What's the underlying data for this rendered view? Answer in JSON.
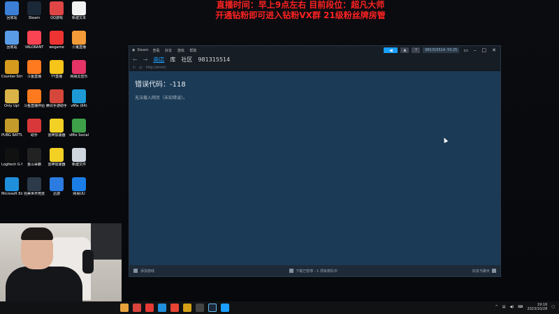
{
  "overlay": {
    "line1": "直播时间：早上9点左右  目前段位：超凡大师",
    "line2": "开通钻粉即可进入钻粉VX群 21级粉丝牌房管"
  },
  "desktop_icons": [
    {
      "label": "回收站",
      "icon": "recycle-bin-icon",
      "color": "#3c7fd6"
    },
    {
      "label": "Steam",
      "icon": "steam-icon",
      "color": "#1b2838"
    },
    {
      "label": "QQ游戏",
      "icon": "qq-game-icon",
      "color": "#e04646"
    },
    {
      "label": "新建文本",
      "icon": "text-file-icon",
      "color": "#f2f2f2"
    },
    {
      "label": "回收站",
      "icon": "bin-icon",
      "color": "#5a9be6"
    },
    {
      "label": "VALORANT",
      "icon": "valorant-icon",
      "color": "#fa4454"
    },
    {
      "label": "wegame",
      "icon": "wegame-icon",
      "color": "#e33"
    },
    {
      "label": "小鬼直播",
      "icon": "dog-icon",
      "color": "#f29b38"
    },
    {
      "label": "Counter-Strike",
      "icon": "cs-icon",
      "color": "#d69b1e"
    },
    {
      "label": "斗鱼直播",
      "icon": "douyu-icon",
      "color": "#ff7a1f"
    },
    {
      "label": "YY直播",
      "icon": "yy-icon",
      "color": "#f7c419"
    },
    {
      "label": "网易云音乐",
      "icon": "music-icon",
      "color": "#e63466"
    },
    {
      "label": "Only Up!",
      "icon": "onlyup-icon",
      "color": "#d9b347"
    },
    {
      "label": "斗鱼直播伴侣",
      "icon": "douyu-partner-icon",
      "color": "#ff7a1f"
    },
    {
      "label": "腾讯手游助手",
      "icon": "tencent-icon",
      "color": "#d5473a"
    },
    {
      "label": "vMix (64)",
      "icon": "vmix-icon",
      "color": "#1d9ad6"
    },
    {
      "label": "PUBG BATTLEGR",
      "icon": "pubg-icon",
      "color": "#c49b2a"
    },
    {
      "label": "助手",
      "icon": "helper-icon",
      "color": "#d9383a"
    },
    {
      "label": "雷神加速器",
      "icon": "thunder-icon",
      "color": "#f2d024"
    },
    {
      "label": "vMix Social",
      "icon": "vmix-social-icon",
      "color": "#3fa04a"
    },
    {
      "label": "Logitech G HUB",
      "icon": "logitech-icon",
      "color": "#111"
    },
    {
      "label": "金山毒霸",
      "icon": "guard-icon",
      "color": "#222"
    },
    {
      "label": "雷神加速器",
      "icon": "thunder2-icon",
      "color": "#f2d024"
    },
    {
      "label": "新建文件",
      "icon": "folder-icon",
      "color": "#cfd6de"
    },
    {
      "label": "Microsoft Edge",
      "icon": "edge-icon",
      "color": "#1f8fdc"
    },
    {
      "label": "完美世界竞技平台",
      "icon": "perfect-icon",
      "color": "#2c3a4a"
    },
    {
      "label": "迅游",
      "icon": "xunyou-icon",
      "color": "#2b7be0"
    },
    {
      "label": "网易UU",
      "icon": "uu-icon",
      "color": "#1b7ee6"
    }
  ],
  "steam": {
    "title": "Steam",
    "menu": [
      "查看",
      "好友",
      "游戏",
      "帮助"
    ],
    "account": "981315514",
    "balance": "¥3.25",
    "nav_tabs": [
      "商店",
      "库",
      "社区"
    ],
    "nav_user": "981315514",
    "url": "http://error/",
    "error_title": "错误代码：-118",
    "error_sub": "无法载入网页（未知错误）。",
    "status_left": "添加游戏",
    "status_mid": "下载已暂停 - 1 项目排队中",
    "status_right": "好友与聊天"
  },
  "taskbar": {
    "time": "19:16",
    "date": "2023/10/28"
  }
}
